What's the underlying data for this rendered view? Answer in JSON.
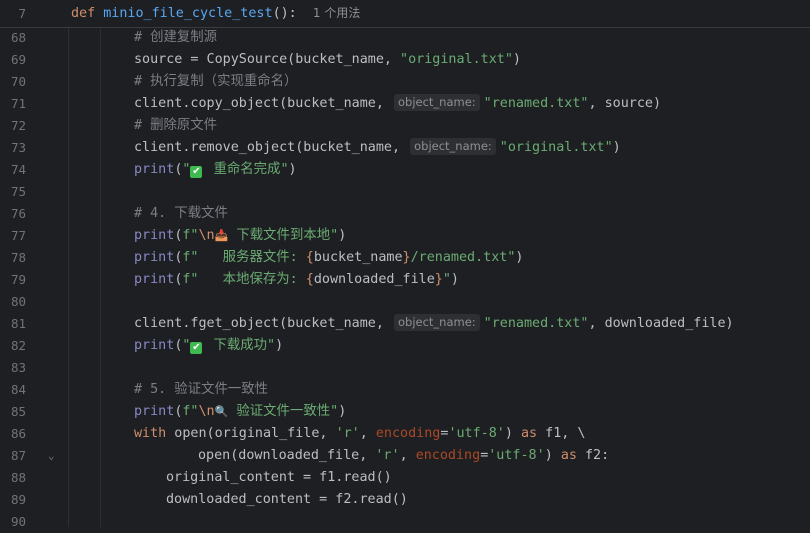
{
  "sticky": {
    "line": "7",
    "keyword": "def",
    "function_name": "minio_file_cycle_test",
    "suffix": "():",
    "usage_hint": "1 个用法"
  },
  "lines": [
    {
      "n": "68"
    },
    {
      "n": "69"
    },
    {
      "n": "70"
    },
    {
      "n": "71"
    },
    {
      "n": "72"
    },
    {
      "n": "73"
    },
    {
      "n": "74"
    },
    {
      "n": "75"
    },
    {
      "n": "76"
    },
    {
      "n": "77"
    },
    {
      "n": "78"
    },
    {
      "n": "79"
    },
    {
      "n": "80"
    },
    {
      "n": "81"
    },
    {
      "n": "82"
    },
    {
      "n": "83"
    },
    {
      "n": "84"
    },
    {
      "n": "85"
    },
    {
      "n": "86"
    },
    {
      "n": "87"
    },
    {
      "n": "88"
    },
    {
      "n": "89"
    },
    {
      "n": "90"
    }
  ],
  "code": {
    "l68_comment": "# 创建复制源",
    "l69_a": "source = CopySource(bucket_name, ",
    "l69_str": "\"original.txt\"",
    "l69_b": ")",
    "l70_comment": "# 执行复制（实现重命名）",
    "l71_a": "client.copy_object(bucket_name, ",
    "l71_hint": "object_name:",
    "l71_str": "\"renamed.txt\"",
    "l71_b": ", source)",
    "l72_comment": "# 删除原文件",
    "l73_a": "client.remove_object(bucket_name, ",
    "l73_hint": "object_name:",
    "l73_str": "\"original.txt\"",
    "l73_b": ")",
    "l74_fn": "print",
    "l74_a": "(",
    "l74_emoji": "✔",
    "l74_str_a": "\"",
    "l74_str_b": " 重命名完成\"",
    "l74_b": ")",
    "l76_comment": "# 4. 下载文件",
    "l77_fn": "print",
    "l77_a": "(",
    "l77_f": "f\"",
    "l77_esc": "\\n",
    "l77_emoji": "📥",
    "l77_str": " 下载文件到本地\"",
    "l77_b": ")",
    "l78_fn": "print",
    "l78_a": "(",
    "l78_str_a": "f\"   服务器文件: ",
    "l78_brace_open": "{",
    "l78_var": "bucket_name",
    "l78_brace_close": "}",
    "l78_str_b": "/renamed.txt\"",
    "l78_b": ")",
    "l79_fn": "print",
    "l79_a": "(",
    "l79_str_a": "f\"   本地保存为: ",
    "l79_brace_open": "{",
    "l79_var": "downloaded_file",
    "l79_brace_close": "}",
    "l79_str_b": "\"",
    "l79_b": ")",
    "l81_a": "client.fget_object(bucket_name, ",
    "l81_hint": "object_name:",
    "l81_str": "\"renamed.txt\"",
    "l81_b": ", downloaded_file)",
    "l82_fn": "print",
    "l82_a": "(",
    "l82_emoji": "✔",
    "l82_str_a": "\"",
    "l82_str_b": " 下载成功\"",
    "l82_b": ")",
    "l84_comment": "# 5. 验证文件一致性",
    "l85_fn": "print",
    "l85_a": "(",
    "l85_f": "f\"",
    "l85_esc": "\\n",
    "l85_emoji": "🔍",
    "l85_str": " 验证文件一致性\"",
    "l85_b": ")",
    "l86_kw": "with",
    "l86_a": " open(original_file, ",
    "l86_str1": "'r'",
    "l86_b": ", ",
    "l86_param": "encoding",
    "l86_eq": "=",
    "l86_str2": "'utf-8'",
    "l86_c": ") ",
    "l86_as": "as",
    "l86_d": " f1, \\",
    "l87_a": "open(downloaded_file, ",
    "l87_str1": "'r'",
    "l87_b": ", ",
    "l87_param": "encoding",
    "l87_eq": "=",
    "l87_str2": "'utf-8'",
    "l87_c": ") ",
    "l87_as": "as",
    "l87_d": " f2:",
    "l88": "original_content = f1.read()",
    "l89": "downloaded_content = f2.read()"
  },
  "colors": {
    "background": "#1e1f22",
    "keyword": "#cf8e6d",
    "function": "#56a8f5",
    "string": "#6aab73",
    "comment": "#7a7e85",
    "parameter": "#aa4926"
  }
}
